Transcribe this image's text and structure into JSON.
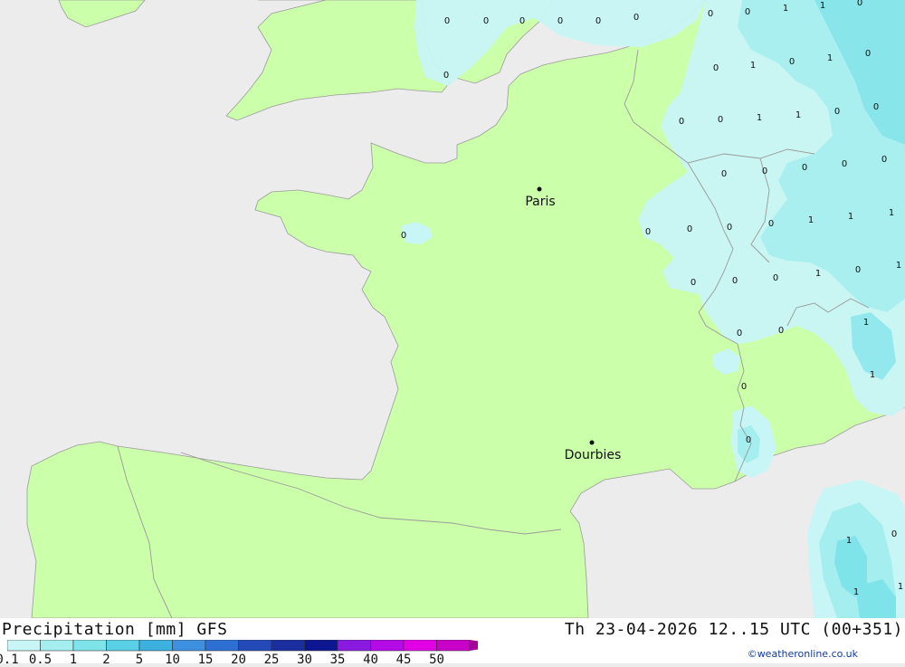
{
  "footer": {
    "title_left": "Precipitation [mm] GFS",
    "title_right": "Th 23-04-2026 12..15 UTC (00+351)",
    "credit": "©weatheronline.co.uk"
  },
  "legend": {
    "ticks": [
      "0.1",
      "0.5",
      "1",
      "2",
      "5",
      "10",
      "15",
      "20",
      "25",
      "30",
      "35",
      "40",
      "45",
      "50"
    ],
    "colors": [
      "#c8f5f5",
      "#a5eef0",
      "#7fe3ea",
      "#5ad0e6",
      "#3cb1e0",
      "#3f8fe0",
      "#2e6fd4",
      "#2449b8",
      "#1a2ea0",
      "#0c1690",
      "#8a1ae0",
      "#b40ae6",
      "#e200e6",
      "#c800c8",
      "#a8009c"
    ]
  },
  "colors": {
    "sea": "#ececec",
    "land": "#ccffaa",
    "precip_light": "#c8f5f5",
    "precip_mid": "#a5eef0",
    "precip_heavy": "#7fe3ea",
    "border": "#999999"
  },
  "cities": [
    {
      "name": "Paris"
    },
    {
      "name": "Dourbies"
    }
  ],
  "precip_values": [
    "0",
    "0",
    "0",
    "0",
    "0",
    "0",
    "0",
    "0",
    "1",
    "1",
    "0",
    "0",
    "1",
    "0",
    "0",
    "1",
    "0",
    "0",
    "0",
    "1",
    "1",
    "0",
    "0",
    "0",
    "0",
    "0",
    "0",
    "0",
    "0",
    "0",
    "0",
    "0",
    "1",
    "1",
    "1",
    "0",
    "0",
    "0",
    "1",
    "0",
    "1",
    "1",
    "0",
    "0",
    "1",
    "0",
    "0",
    "1",
    "0",
    "1",
    "1",
    "0"
  ]
}
